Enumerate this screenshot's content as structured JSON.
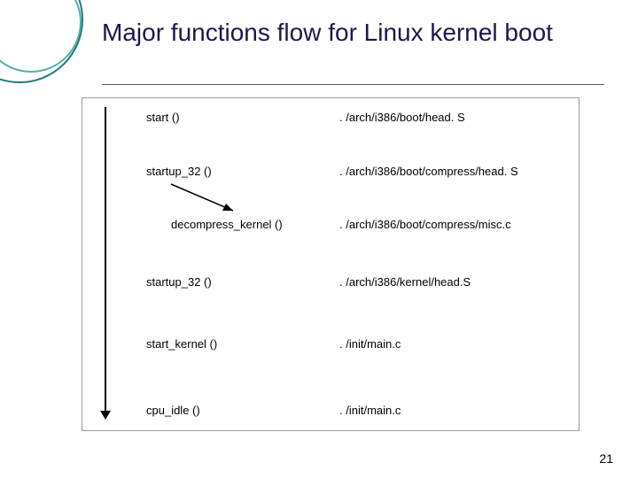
{
  "title": "Major functions flow for Linux kernel boot",
  "page_number": "21",
  "rows": [
    {
      "func": "start ()",
      "path": ". /arch/i386/boot/head. S"
    },
    {
      "func": "startup_32 ()",
      "path": ". /arch/i386/boot/compress/head. S"
    },
    {
      "func": "decompress_kernel ()",
      "path": ". /arch/i386/boot/compress/misc.c"
    },
    {
      "func": "startup_32 ()",
      "path": ". /arch/i386/kernel/head.S"
    },
    {
      "func": "start_kernel ()",
      "path": ". /init/main.c"
    },
    {
      "func": "cpu_idle ()",
      "path": ". /init/main.c"
    }
  ]
}
